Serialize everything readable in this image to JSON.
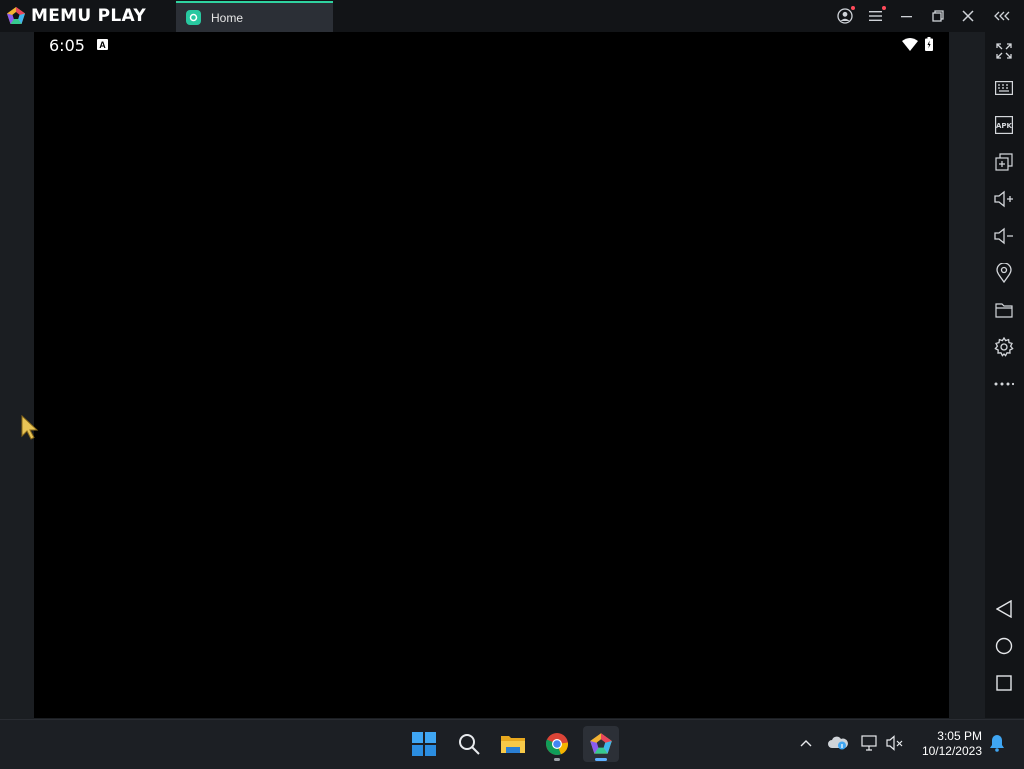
{
  "app": {
    "name": "MEMU PLAY"
  },
  "tab": {
    "label": "Home"
  },
  "android": {
    "time": "6:05",
    "status_icons": [
      "a-icon",
      "wifi-icon",
      "battery-icon"
    ]
  },
  "titlebar_buttons": [
    "account-icon",
    "menu-icon",
    "minimize-icon",
    "restore-icon",
    "close-icon",
    "collapse-icon"
  ],
  "sidebar": {
    "items": [
      "fullscreen-icon",
      "keyboard-icon",
      "apk-icon",
      "multi-instance-icon",
      "volume-up-icon",
      "volume-down-icon",
      "location-icon",
      "folder-icon",
      "settings-icon",
      "more-icon"
    ],
    "nav": [
      "back-icon",
      "home-icon",
      "recents-icon"
    ]
  },
  "taskbar": {
    "apps": [
      "windows-start-icon",
      "search-icon",
      "file-explorer-icon",
      "chrome-icon",
      "memu-icon"
    ],
    "time": "3:05 PM",
    "date": "10/12/2023"
  },
  "colors": {
    "accent": "#2fd3a0",
    "titlebar": "#121417",
    "screen": "#000000",
    "taskbar": "#1c1f24"
  }
}
